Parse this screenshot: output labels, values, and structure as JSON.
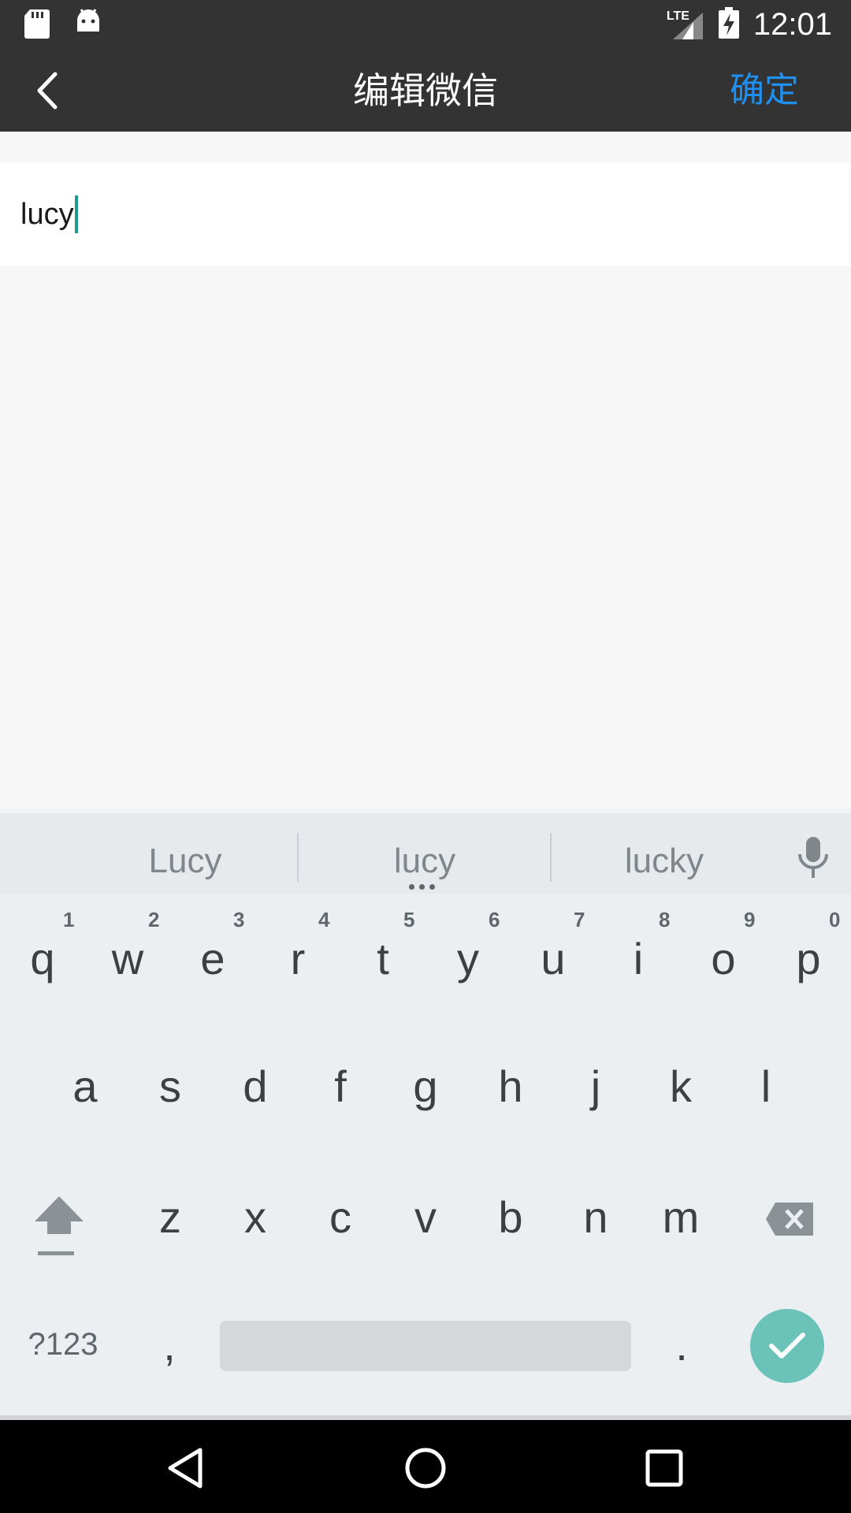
{
  "status_bar": {
    "time": "12:01",
    "network_label": "LTE",
    "icons": [
      "sd-card-icon",
      "android-debug-icon",
      "lte-signal-icon",
      "battery-charging-icon"
    ]
  },
  "toolbar": {
    "title": "编辑微信",
    "confirm_label": "确定",
    "accent_color": "#1f8ff0",
    "back_icon": "chevron-left-icon"
  },
  "input": {
    "value": "lucy"
  },
  "keyboard": {
    "suggestions": [
      "Lucy",
      "lucy",
      "lucky"
    ],
    "row1": [
      "q",
      "w",
      "e",
      "r",
      "t",
      "y",
      "u",
      "i",
      "o",
      "p"
    ],
    "row1_hints": [
      "1",
      "2",
      "3",
      "4",
      "5",
      "6",
      "7",
      "8",
      "9",
      "0"
    ],
    "row2": [
      "a",
      "s",
      "d",
      "f",
      "g",
      "h",
      "j",
      "k",
      "l"
    ],
    "row3": [
      "z",
      "x",
      "c",
      "v",
      "b",
      "n",
      "m"
    ],
    "symbols_label": "?123",
    "comma": ",",
    "period": ".",
    "enter_color": "#6bc2b8"
  },
  "nav_bar": {
    "icons": [
      "back-triangle-icon",
      "home-circle-icon",
      "recents-square-icon"
    ]
  }
}
